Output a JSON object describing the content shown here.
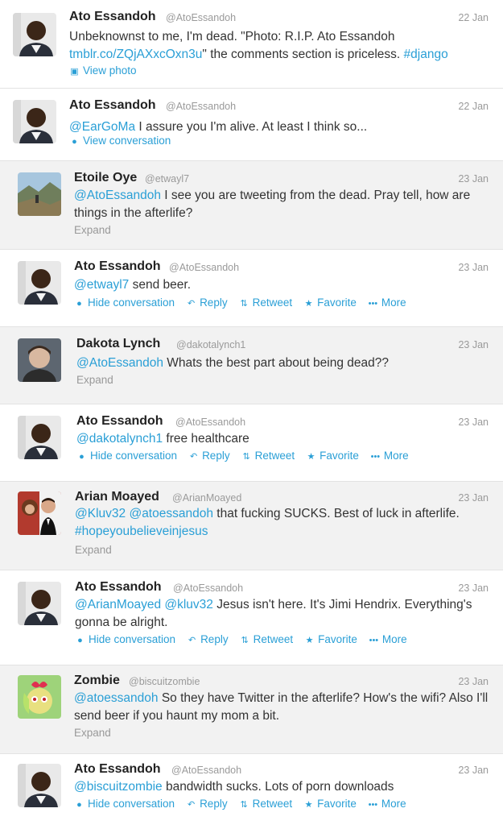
{
  "tweets": [
    {
      "name": "Ato Essandoh",
      "handle": "@AtoEssandoh",
      "date": "22 Jan",
      "text_before": "Unbeknownst to me, I'm dead. \"Photo: R.I.P. Ato Essandoh ",
      "text_link": "tmblr.co/ZQjAXxcOxn3u",
      "text_after": "\" the comments section is priceless. ",
      "text_hashtag": "#django",
      "view_label": "View photo"
    },
    {
      "name": "Ato Essandoh",
      "handle": "@AtoEssandoh",
      "date": "22 Jan",
      "mention": "@EarGoMa",
      "text": " I assure you I'm alive. At least I think so...",
      "view_label": "View conversation"
    },
    {
      "name": "Etoile Oye",
      "handle": "@etwayl7",
      "date": "23 Jan",
      "mention": "@AtoEssandoh",
      "text": " I see you are tweeting from the dead. Pray tell, how are things in the afterlife?",
      "expand": "Expand"
    },
    {
      "name": "Ato Essandoh",
      "handle": "@AtoEssandoh",
      "date": "23 Jan",
      "mention": "@etwayl7",
      "text": " send beer."
    },
    {
      "name": "Dakota Lynch",
      "handle": "@dakotalynch1",
      "date": "23 Jan",
      "mention": "@AtoEssandoh",
      "text": " Whats the best part about being dead??",
      "expand": "Expand"
    },
    {
      "name": "Ato Essandoh",
      "handle": "@AtoEssandoh",
      "date": "23 Jan",
      "mention": "@dakotalynch1",
      "text": " free healthcare"
    },
    {
      "name": "Arian Moayed",
      "handle": "@ArianMoayed",
      "date": "23 Jan",
      "mention": "@Kluv32",
      "mention2": "@atoessandoh",
      "text": " that fucking SUCKS. Best of luck in afterlife. ",
      "hashtag": "#hopeyoubelieveinjesus",
      "expand": "Expand"
    },
    {
      "name": "Ato Essandoh",
      "handle": "@AtoEssandoh",
      "date": "23 Jan",
      "mention": "@ArianMoayed",
      "mention2": "@kluv32",
      "text": " Jesus isn't here. It's Jimi Hendrix. Everything's gonna be alright."
    },
    {
      "name": "Zombie",
      "handle": "@biscuitzombie",
      "date": "23 Jan",
      "mention": "@atoessandoh",
      "text": " So they have Twitter in the afterlife? How's the wifi? Also I'll send beer if you haunt my mom a bit.",
      "expand": "Expand"
    },
    {
      "name": "Ato Essandoh",
      "handle": "@AtoEssandoh",
      "date": "23 Jan",
      "mention": "@biscuitzombie",
      "text": " bandwidth sucks. Lots of porn downloads"
    }
  ],
  "actions": {
    "hide": "Hide conversation",
    "reply": "Reply",
    "retweet": "Retweet",
    "favorite": "Favorite",
    "more": "More"
  },
  "icons": {
    "photo": "photo-icon",
    "conversation": "conversation-bubble-icon",
    "reply": "reply-arrow-icon",
    "retweet": "retweet-icon",
    "favorite": "star-icon",
    "more": "ellipsis-icon"
  },
  "colors": {
    "link": "#2a9fd6",
    "alt_row": "#f2f2f2",
    "muted": "#999999"
  }
}
